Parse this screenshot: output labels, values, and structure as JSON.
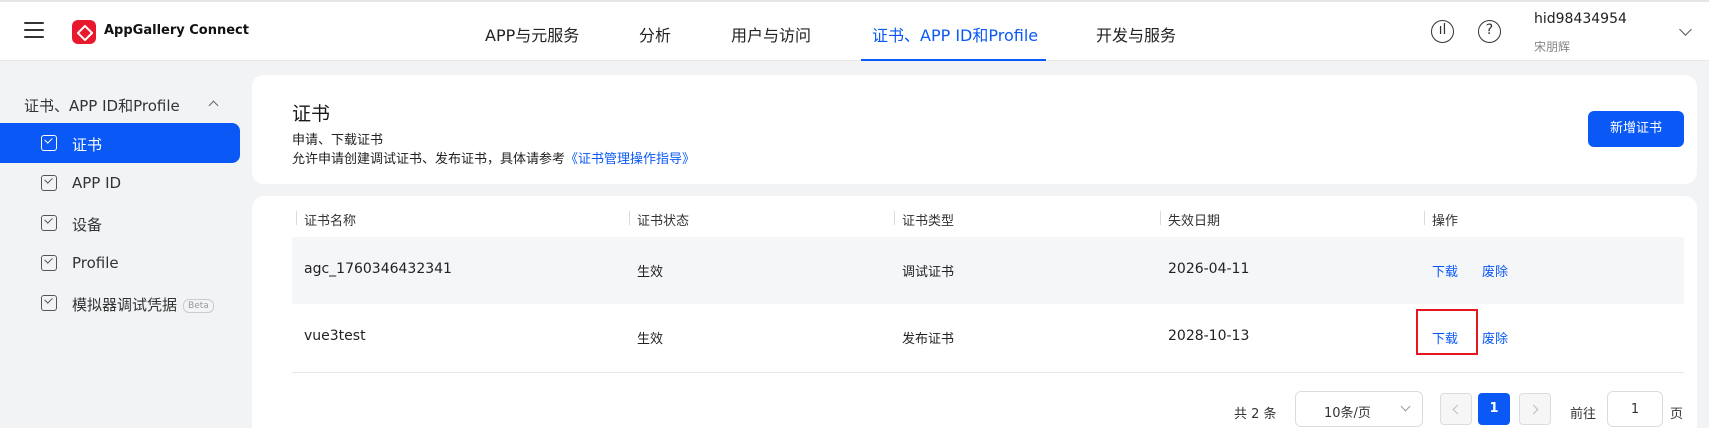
{
  "header": {
    "brand": "AppGallery Connect",
    "nav": [
      "APP与元服务",
      "分析",
      "用户与访问",
      "证书、APP ID和Profile",
      "开发与服务"
    ],
    "active_nav_index": 3,
    "user_name": "hid98434954",
    "user_sub": "宋朋辉",
    "icons": [
      "menu-icon",
      "feedback-icon",
      "help-icon",
      "chevron-down-icon"
    ]
  },
  "sidebar": {
    "group_label": "证书、APP ID和Profile",
    "items": [
      {
        "label": "证书",
        "active": true
      },
      {
        "label": "APP ID",
        "active": false
      },
      {
        "label": "设备",
        "active": false
      },
      {
        "label": "Profile",
        "active": false
      },
      {
        "label": "模拟器调试凭据",
        "badge": "Beta",
        "active": false
      }
    ]
  },
  "page": {
    "title": "证书",
    "subtitle": "申请、下载证书",
    "desc_prefix": "允许申请创建调试证书、发布证书，具体请参考",
    "desc_link": "《证书管理操作指导》",
    "add_button": "新增证书"
  },
  "table": {
    "columns": [
      "证书名称",
      "证书状态",
      "证书类型",
      "失效日期",
      "操作"
    ],
    "rows": [
      {
        "name": "agc_1760346432341",
        "status": "生效",
        "type": "调试证书",
        "expiry": "2026-04-11",
        "download": "下载",
        "revoke": "废除"
      },
      {
        "name": "vue3test",
        "status": "生效",
        "type": "发布证书",
        "expiry": "2028-10-13",
        "download": "下载",
        "revoke": "废除"
      }
    ]
  },
  "pagination": {
    "total": "共 2 条",
    "page_size": "10条/页",
    "current_page": "1",
    "goto_label": "前往",
    "goto_value": "1",
    "goto_unit": "页"
  },
  "colors": {
    "accent": "#0a59f7",
    "highlight": "#e5161f",
    "logo": "#e8192c"
  }
}
